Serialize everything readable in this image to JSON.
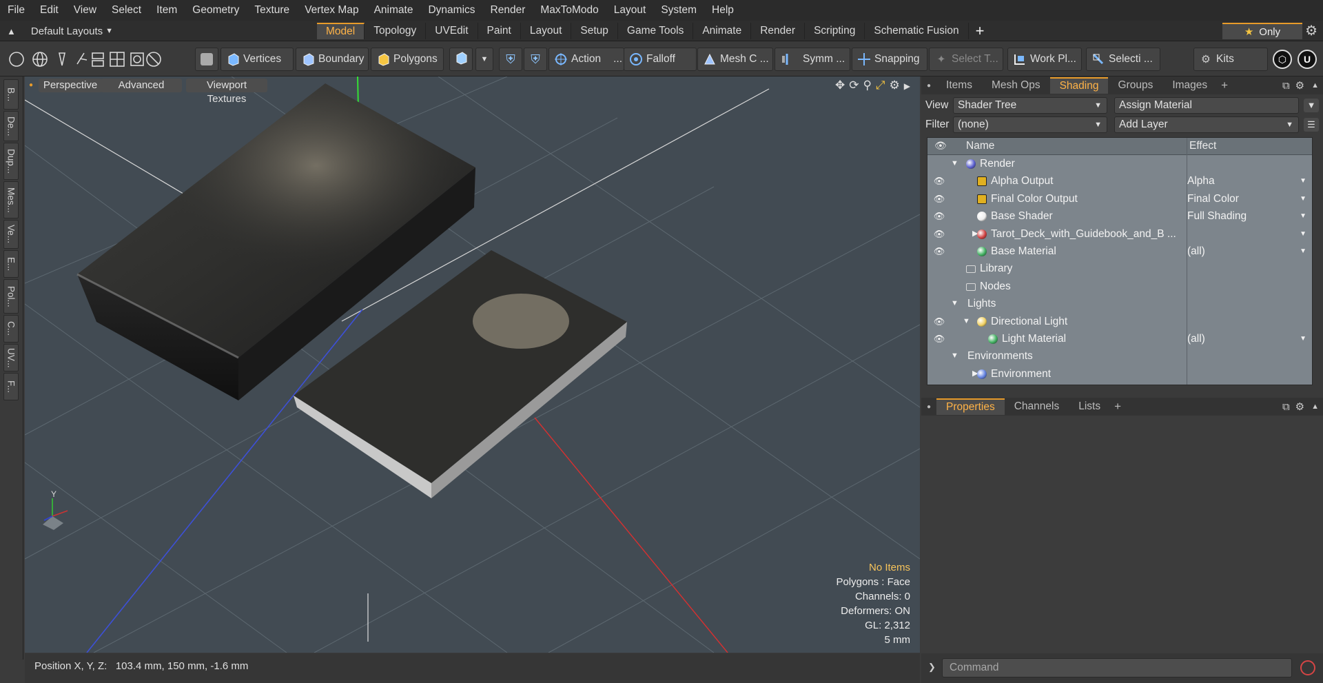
{
  "menu": [
    "File",
    "Edit",
    "View",
    "Select",
    "Item",
    "Geometry",
    "Texture",
    "Vertex Map",
    "Animate",
    "Dynamics",
    "Render",
    "MaxToModo",
    "Layout",
    "System",
    "Help"
  ],
  "layouts": {
    "label": "Default Layouts"
  },
  "tabs": [
    "Model",
    "Topology",
    "UVEdit",
    "Paint",
    "Layout",
    "Setup",
    "Game Tools",
    "Animate",
    "Render",
    "Scripting",
    "Schematic Fusion"
  ],
  "active_tab": "Model",
  "only_label": "Only",
  "toolbar": {
    "vertices": "Vertices",
    "boundary": "Boundary",
    "polygons": "Polygons",
    "action": "Action",
    "action_more": "...",
    "falloff": "Falloff",
    "mesh_c": "Mesh C ...",
    "symm": "Symm ...",
    "snapping": "Snapping",
    "select_t": "Select T...",
    "work_pl": "Work Pl...",
    "selecti": "Selecti ...",
    "kits": "Kits"
  },
  "left_tabs": [
    "B...",
    "De...",
    "Dup...",
    "Mes...",
    "Ve...",
    "E...",
    "Pol...",
    "C...",
    "UV...",
    "F..."
  ],
  "viewport": {
    "perspective": "Perspective",
    "advanced": "Advanced",
    "viewport_textures": "Viewport Textures",
    "info": {
      "items": "No Items",
      "polygons": "Polygons : Face",
      "channels": "Channels: 0",
      "deformers": "Deformers: ON",
      "gl": "GL: 2,312",
      "scale": "5 mm"
    }
  },
  "panel_tabs": [
    "Items",
    "Mesh Ops",
    "Shading",
    "Groups",
    "Images"
  ],
  "active_panel_tab": "Shading",
  "shading": {
    "view_label": "View",
    "view_value": "Shader Tree",
    "assign_material": "Assign Material",
    "filter_label": "Filter",
    "filter_value": "(none)",
    "add_layer": "Add Layer",
    "col_name": "Name",
    "col_effect": "Effect",
    "rows": [
      {
        "name": "Render",
        "effect": "",
        "level": 0,
        "icon": "render-sphere-icon",
        "color": "#5a5fd0",
        "eye": false,
        "exp": "down"
      },
      {
        "name": "Alpha Output",
        "effect": "Alpha",
        "level": 1,
        "icon": "output-icon",
        "color": "#e0b020",
        "eye": true,
        "exp": ""
      },
      {
        "name": "Final Color Output",
        "effect": "Final Color",
        "level": 1,
        "icon": "output-icon",
        "color": "#e0b020",
        "eye": true,
        "exp": ""
      },
      {
        "name": "Base Shader",
        "effect": "Full Shading",
        "level": 1,
        "icon": "shader-icon",
        "color": "#eeeeee",
        "eye": true,
        "exp": ""
      },
      {
        "name": "Tarot_Deck_with_Guidebook_and_B ...",
        "effect": "",
        "level": 1,
        "icon": "material-group-icon",
        "color": "#d04040",
        "eye": true,
        "exp": "right"
      },
      {
        "name": "Base Material",
        "effect": "(all)",
        "level": 1,
        "icon": "material-icon",
        "color": "#40b060",
        "eye": true,
        "exp": ""
      },
      {
        "name": "Library",
        "effect": "",
        "level": 0,
        "icon": "folder-icon",
        "color": "#d8d8d8",
        "eye": false,
        "exp": ""
      },
      {
        "name": "Nodes",
        "effect": "",
        "level": 0,
        "icon": "folder-icon",
        "color": "#d8d8d8",
        "eye": false,
        "exp": ""
      },
      {
        "name": "Lights",
        "effect": "",
        "level": -1,
        "icon": "",
        "color": "",
        "eye": false,
        "exp": "down"
      },
      {
        "name": "Directional Light",
        "effect": "",
        "level": 1,
        "icon": "light-icon",
        "color": "#f0d060",
        "eye": true,
        "exp": "down"
      },
      {
        "name": "Light Material",
        "effect": "(all)",
        "level": 2,
        "icon": "material-icon",
        "color": "#40b060",
        "eye": true,
        "exp": ""
      },
      {
        "name": "Environments",
        "effect": "",
        "level": -1,
        "icon": "",
        "color": "",
        "eye": false,
        "exp": "down"
      },
      {
        "name": "Environment",
        "effect": "",
        "level": 1,
        "icon": "environment-icon",
        "color": "#6080e0",
        "eye": false,
        "exp": "right"
      }
    ]
  },
  "props_tabs": [
    "Properties",
    "Channels",
    "Lists"
  ],
  "active_props_tab": "Properties",
  "status": {
    "position": "Position X, Y, Z:   103.4 mm, 150 mm, -1.6 mm"
  },
  "command": {
    "placeholder": "Command"
  }
}
